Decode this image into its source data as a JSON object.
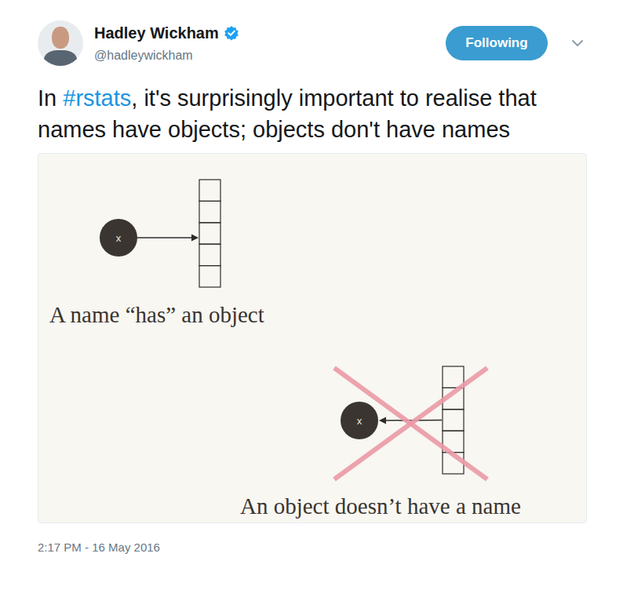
{
  "author": {
    "name": "Hadley Wickham",
    "handle": "@hadleywickham",
    "verified": true
  },
  "follow_button": {
    "label": "Following",
    "selected": true
  },
  "tweet": {
    "text_parts": [
      {
        "text": "In ",
        "kind": "plain"
      },
      {
        "text": "#rstats",
        "kind": "hashtag"
      },
      {
        "text": ", it's surprisingly important to realise that names have objects; objects don't have names",
        "kind": "plain"
      }
    ]
  },
  "image": {
    "diagrams": [
      {
        "caption": "A name “has” an object",
        "circle_label": "x",
        "kind": "name-to-object",
        "crossed": false,
        "cells": 5
      },
      {
        "caption": "An object doesn’t have a name",
        "circle_label": "x",
        "kind": "object-to-name",
        "crossed": true,
        "cells": 5
      }
    ]
  },
  "timestamp": "2:17 PM - 16 May 2016"
}
